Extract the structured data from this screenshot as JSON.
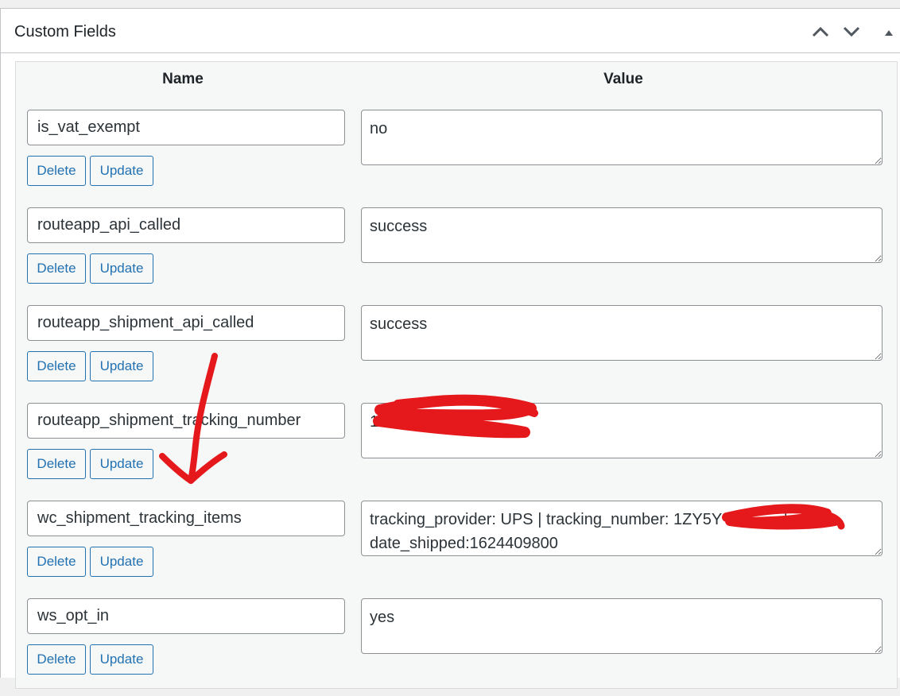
{
  "panel": {
    "title": "Custom Fields",
    "move_up_icon": "chevron-up-icon",
    "move_down_icon": "chevron-down-icon",
    "toggle_icon": "caret-up-icon"
  },
  "table": {
    "headers": {
      "name": "Name",
      "value": "Value"
    }
  },
  "buttons": {
    "delete_label": "Delete",
    "update_label": "Update"
  },
  "fields": [
    {
      "key": "is_vat_exempt",
      "value": "no"
    },
    {
      "key": "routeapp_api_called",
      "value": "success"
    },
    {
      "key": "routeapp_shipment_api_called",
      "value": "success"
    },
    {
      "key": "routeapp_shipment_tracking_number",
      "value": "1Z",
      "redacted": true
    },
    {
      "key": "wc_shipment_tracking_items",
      "value": "tracking_provider: UPS | tracking_number: 1ZY5Y              | date_shipped:1624409800",
      "redacted": true
    },
    {
      "key": "ws_opt_in",
      "value": "yes"
    }
  ],
  "colors": {
    "accent": "#2271b1",
    "annotation": "#e5191c",
    "border": "#8c8f94",
    "table_bg": "#f6f7f7"
  }
}
